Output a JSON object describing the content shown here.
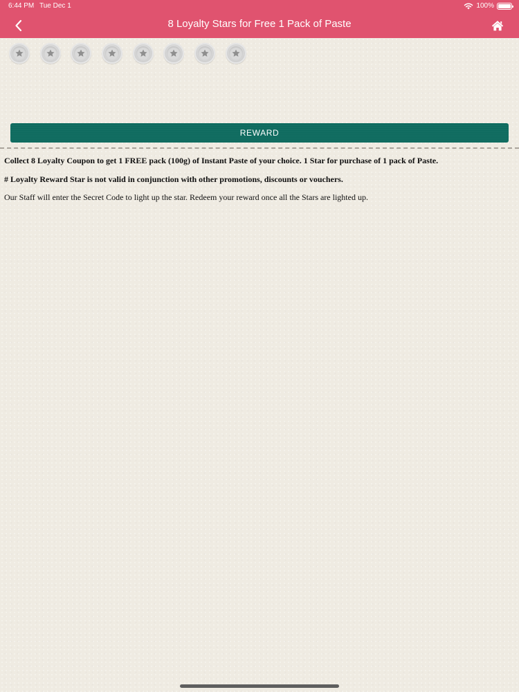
{
  "status_bar": {
    "time": "6:44 PM",
    "date": "Tue Dec 1",
    "battery": "100%",
    "battery_level": 1.0
  },
  "header": {
    "title": "8 Loyalty Stars for Free 1 Pack of  Paste",
    "back_icon": "chevron-left-icon",
    "home_icon": "home-icon",
    "color": "#e0536f"
  },
  "stars": {
    "total": 8,
    "lit": 0,
    "icon": "star-icon"
  },
  "reward_button": {
    "label": "REWARD",
    "color": "#0f6b5f"
  },
  "description": {
    "line1": "Collect 8 Loyalty Coupon to get 1 FREE pack (100g) of Instant Paste of your choice. 1 Star for purchase of 1 pack of Paste.",
    "line2": "# Loyalty Reward Star is not valid in conjunction with other promotions, discounts or vouchers.",
    "line3": "Our Staff will enter the Secret Code to light up the star. Redeem your reward once all the Stars are lighted up."
  }
}
